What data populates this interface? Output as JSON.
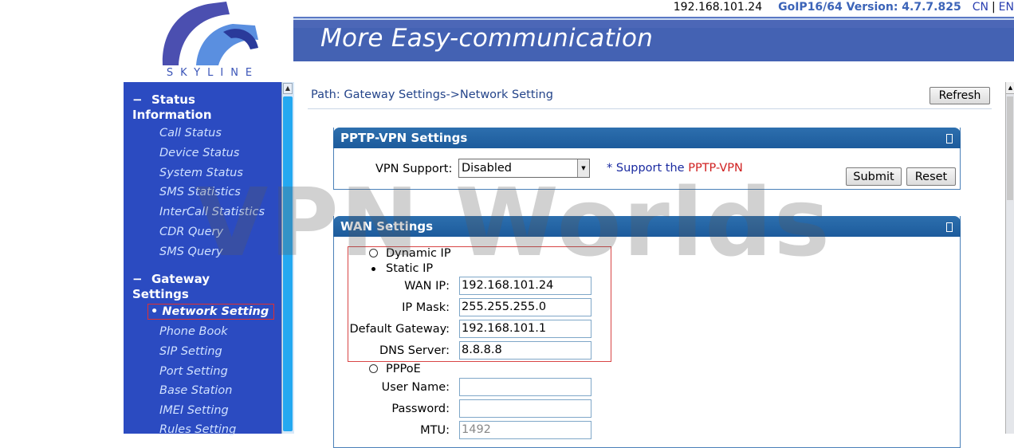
{
  "header": {
    "logo_text": "SKYLINE",
    "ip": "192.168.101.24",
    "version": "GoIP16/64 Version: 4.7.7.825",
    "lang_cn": "CN",
    "lang_sep": "|",
    "lang_en": "EN",
    "banner_title": "More Easy-communication"
  },
  "sidebar": {
    "groups": [
      {
        "title_line1": "Status",
        "title_line2": "Information",
        "items": [
          "Call Status",
          "Device Status",
          "System Status",
          "SMS Statistics",
          "InterCall Statistics",
          "CDR Query",
          "SMS Query"
        ]
      },
      {
        "title_line1": "Gateway",
        "title_line2": "Settings",
        "items": [
          "Network Setting",
          "Phone Book",
          "SIP Setting",
          "Port Setting",
          "Base Station",
          "IMEI Setting",
          "Rules Setting"
        ],
        "active_item": "Network Setting"
      }
    ]
  },
  "main": {
    "path": "Path: Gateway Settings->Network Setting",
    "refresh_label": "Refresh",
    "pptp": {
      "title": "PPTP-VPN Settings",
      "vpn_label": "VPN Support:",
      "vpn_value": "Disabled",
      "support_prefix": "* Support the ",
      "support_highlight": "PPTP-VPN",
      "submit_label": "Submit",
      "reset_label": "Reset"
    },
    "wan": {
      "title": "WAN Settings",
      "dynamic_ip_label": "Dynamic IP",
      "static_ip_label": "Static IP",
      "mode_selected": "Static IP",
      "wan_ip_label": "WAN IP:",
      "wan_ip_value": "192.168.101.24",
      "ip_mask_label": "IP Mask:",
      "ip_mask_value": "255.255.255.0",
      "gateway_label": "Default Gateway:",
      "gateway_value": "192.168.101.1",
      "dns_label": "DNS Server:",
      "dns_value": "8.8.8.8",
      "pppoe_label": "PPPoE",
      "username_label": "User Name:",
      "username_value": "",
      "password_label": "Password:",
      "password_value": "",
      "mtu_label": "MTU:",
      "mtu_value": "1492"
    }
  },
  "watermark": "VPN Worlds",
  "colors": {
    "sidebar_bg": "#2b4bc1",
    "banner_bg": "#4462b3",
    "panel_header": "#1c5b9c",
    "highlight_red": "#d84545"
  }
}
